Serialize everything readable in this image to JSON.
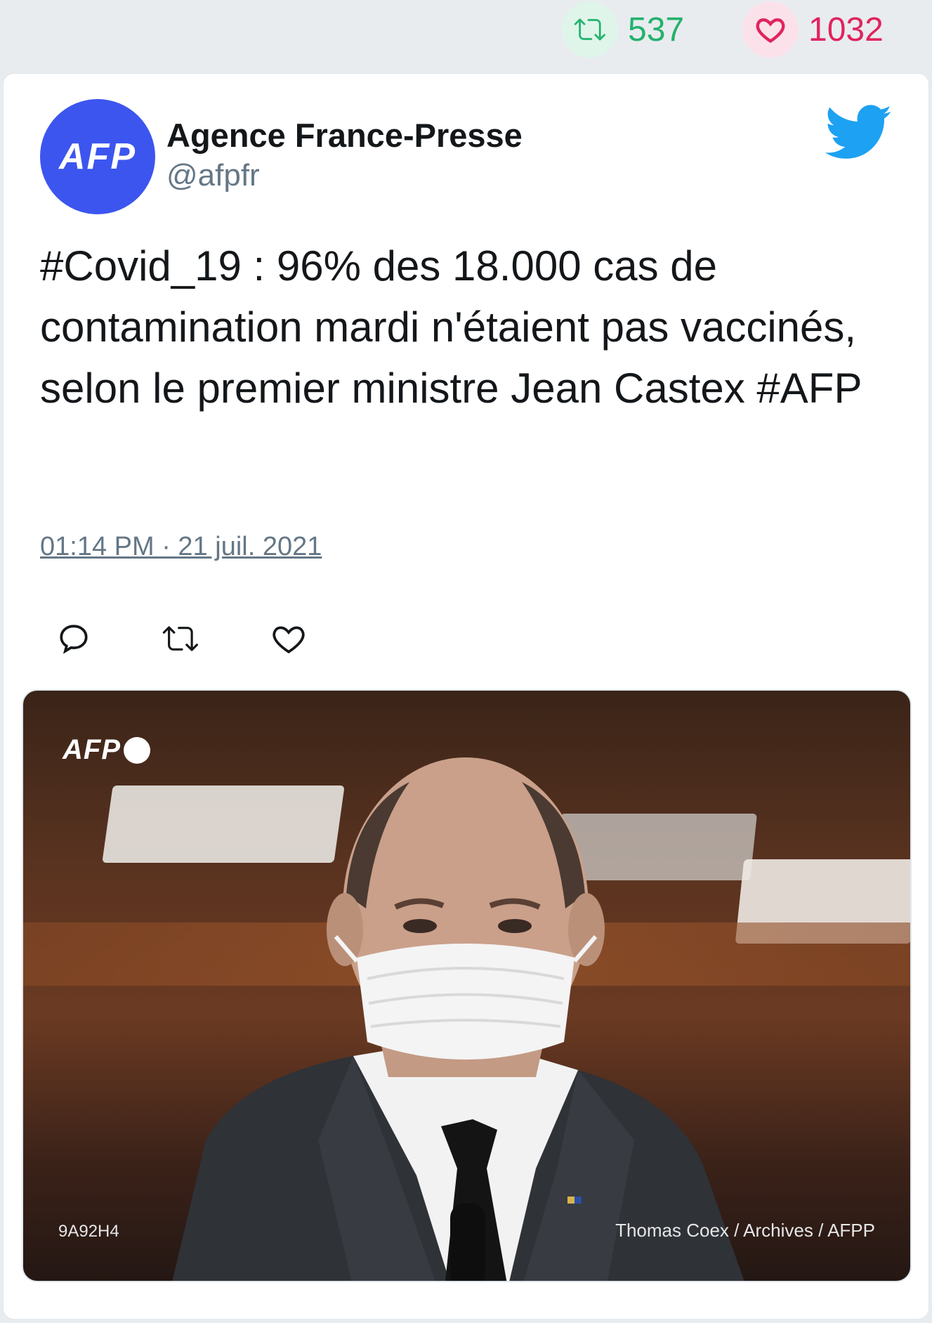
{
  "stats": {
    "retweet_count": "537",
    "like_count": "1032",
    "retweet_icon": "retweet-icon",
    "like_icon": "heart-icon",
    "retweet_color": "#23b26d",
    "like_color": "#e0245e"
  },
  "tweet": {
    "author_name": "Agence France-Presse",
    "author_handle": "@afpfr",
    "avatar_text": "AFP",
    "avatar_color": "#3c55ef",
    "text": "#Covid_19 : 96% des 18.000 cas de contamination mardi n'étaient pas vaccinés, selon le premier ministre Jean Castex #AFP",
    "timestamp": "01:14 PM · 21 juil. 2021",
    "brand_icon": "twitter-bird-icon",
    "brand_color": "#1da1f2",
    "actions": [
      "reply-icon",
      "retweet-icon",
      "like-icon"
    ]
  },
  "media": {
    "watermark": "AFP",
    "photo_id": "9A92H4",
    "credit": "Thomas Coex / Archives / AFPP"
  }
}
